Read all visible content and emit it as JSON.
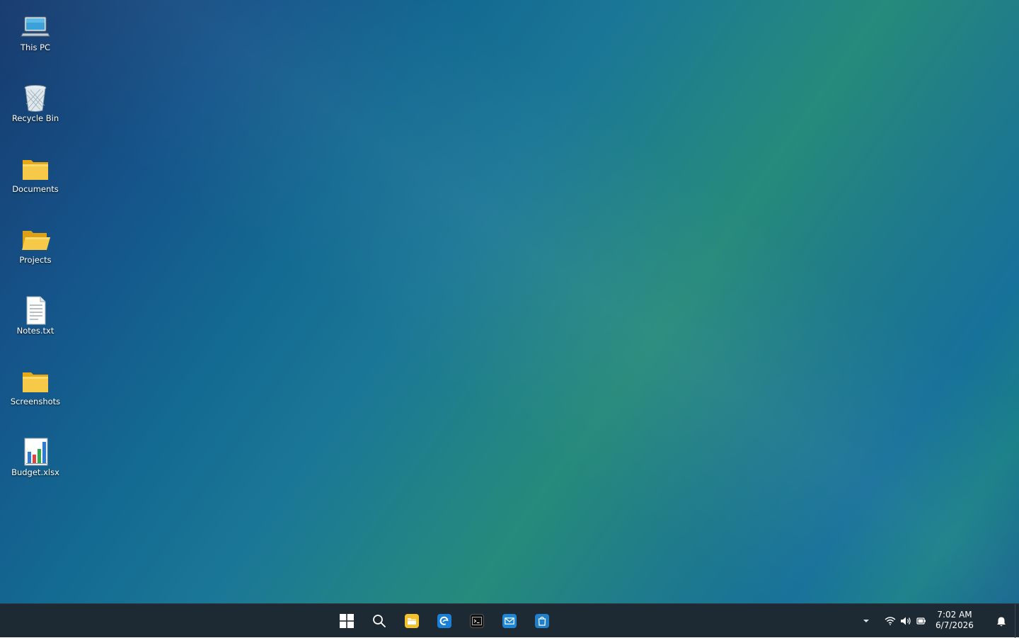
{
  "desktop": {
    "icons": [
      {
        "label": "This PC",
        "icon": "computer-icon"
      },
      {
        "label": "Recycle Bin",
        "icon": "recycle-bin-icon"
      },
      {
        "label": "Documents",
        "icon": "folder-icon"
      },
      {
        "label": "Projects",
        "icon": "open-folder-icon"
      },
      {
        "label": "Notes.txt",
        "icon": "text-document-icon"
      },
      {
        "label": "Screenshots",
        "icon": "folder-icon"
      },
      {
        "label": "Budget.xlsx",
        "icon": "spreadsheet-chart-icon"
      }
    ]
  },
  "taskbar": {
    "pinned": [
      {
        "name": "start",
        "icon": "windows-start-icon"
      },
      {
        "name": "search",
        "icon": "search-icon"
      },
      {
        "name": "file-explorer",
        "icon": "file-explorer-icon",
        "color": "#f2c12e"
      },
      {
        "name": "edge",
        "icon": "edge-browser-icon",
        "color": "#1a7fd6"
      },
      {
        "name": "terminal",
        "icon": "terminal-icon",
        "color": "#111111"
      },
      {
        "name": "mail",
        "icon": "mail-icon",
        "color": "#1f86d6"
      },
      {
        "name": "store",
        "icon": "store-icon",
        "color": "#1f7fc9"
      }
    ],
    "tray": {
      "overflow_icon": "chevron-up-icon",
      "icons": [
        "wifi-icon",
        "volume-icon",
        "battery-icon"
      ]
    },
    "clock": {
      "time": "7:02 AM",
      "date": "6/7/2026"
    },
    "notification_icon": "bell-icon"
  }
}
